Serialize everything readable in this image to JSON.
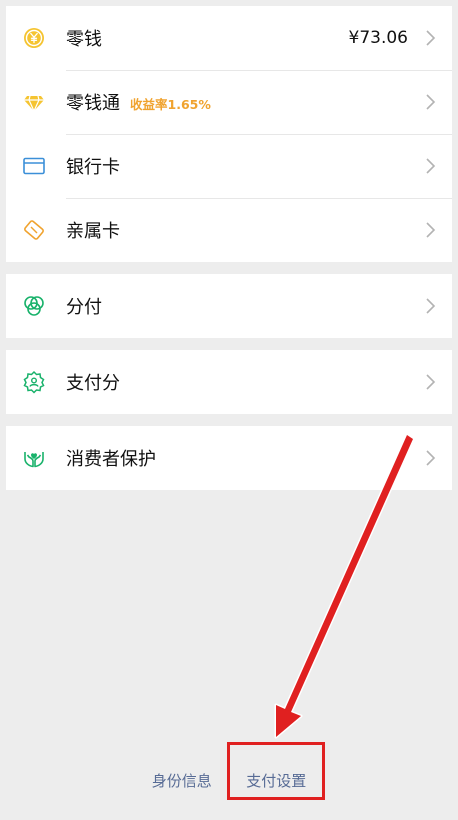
{
  "wallet": {
    "change": {
      "label": "零钱",
      "value": "¥73.06",
      "icon": "yuan-coin-icon",
      "icon_color": "#f5c431"
    },
    "licaitong": {
      "label": "零钱通",
      "sublabel": "收益率1.65%",
      "icon": "diamond-icon",
      "icon_color": "#f5c431"
    },
    "bank_card": {
      "label": "银行卡",
      "icon": "bank-card-icon",
      "icon_color": "#3b8fd8"
    },
    "family_card": {
      "label": "亲属卡",
      "icon": "family-card-icon",
      "icon_color": "#f0a32f"
    }
  },
  "installment": {
    "label": "分付",
    "icon": "installment-icon",
    "icon_color": "#19b26b"
  },
  "pay_score": {
    "label": "支付分",
    "icon": "pay-score-icon",
    "icon_color": "#19b26b"
  },
  "consumer_protection": {
    "label": "消费者保护",
    "icon": "protection-hands-icon",
    "icon_color": "#19b26b"
  },
  "footer": {
    "identity_label": "身份信息",
    "pay_settings_label": "支付设置"
  },
  "annotation": {
    "color": "#e02020"
  }
}
